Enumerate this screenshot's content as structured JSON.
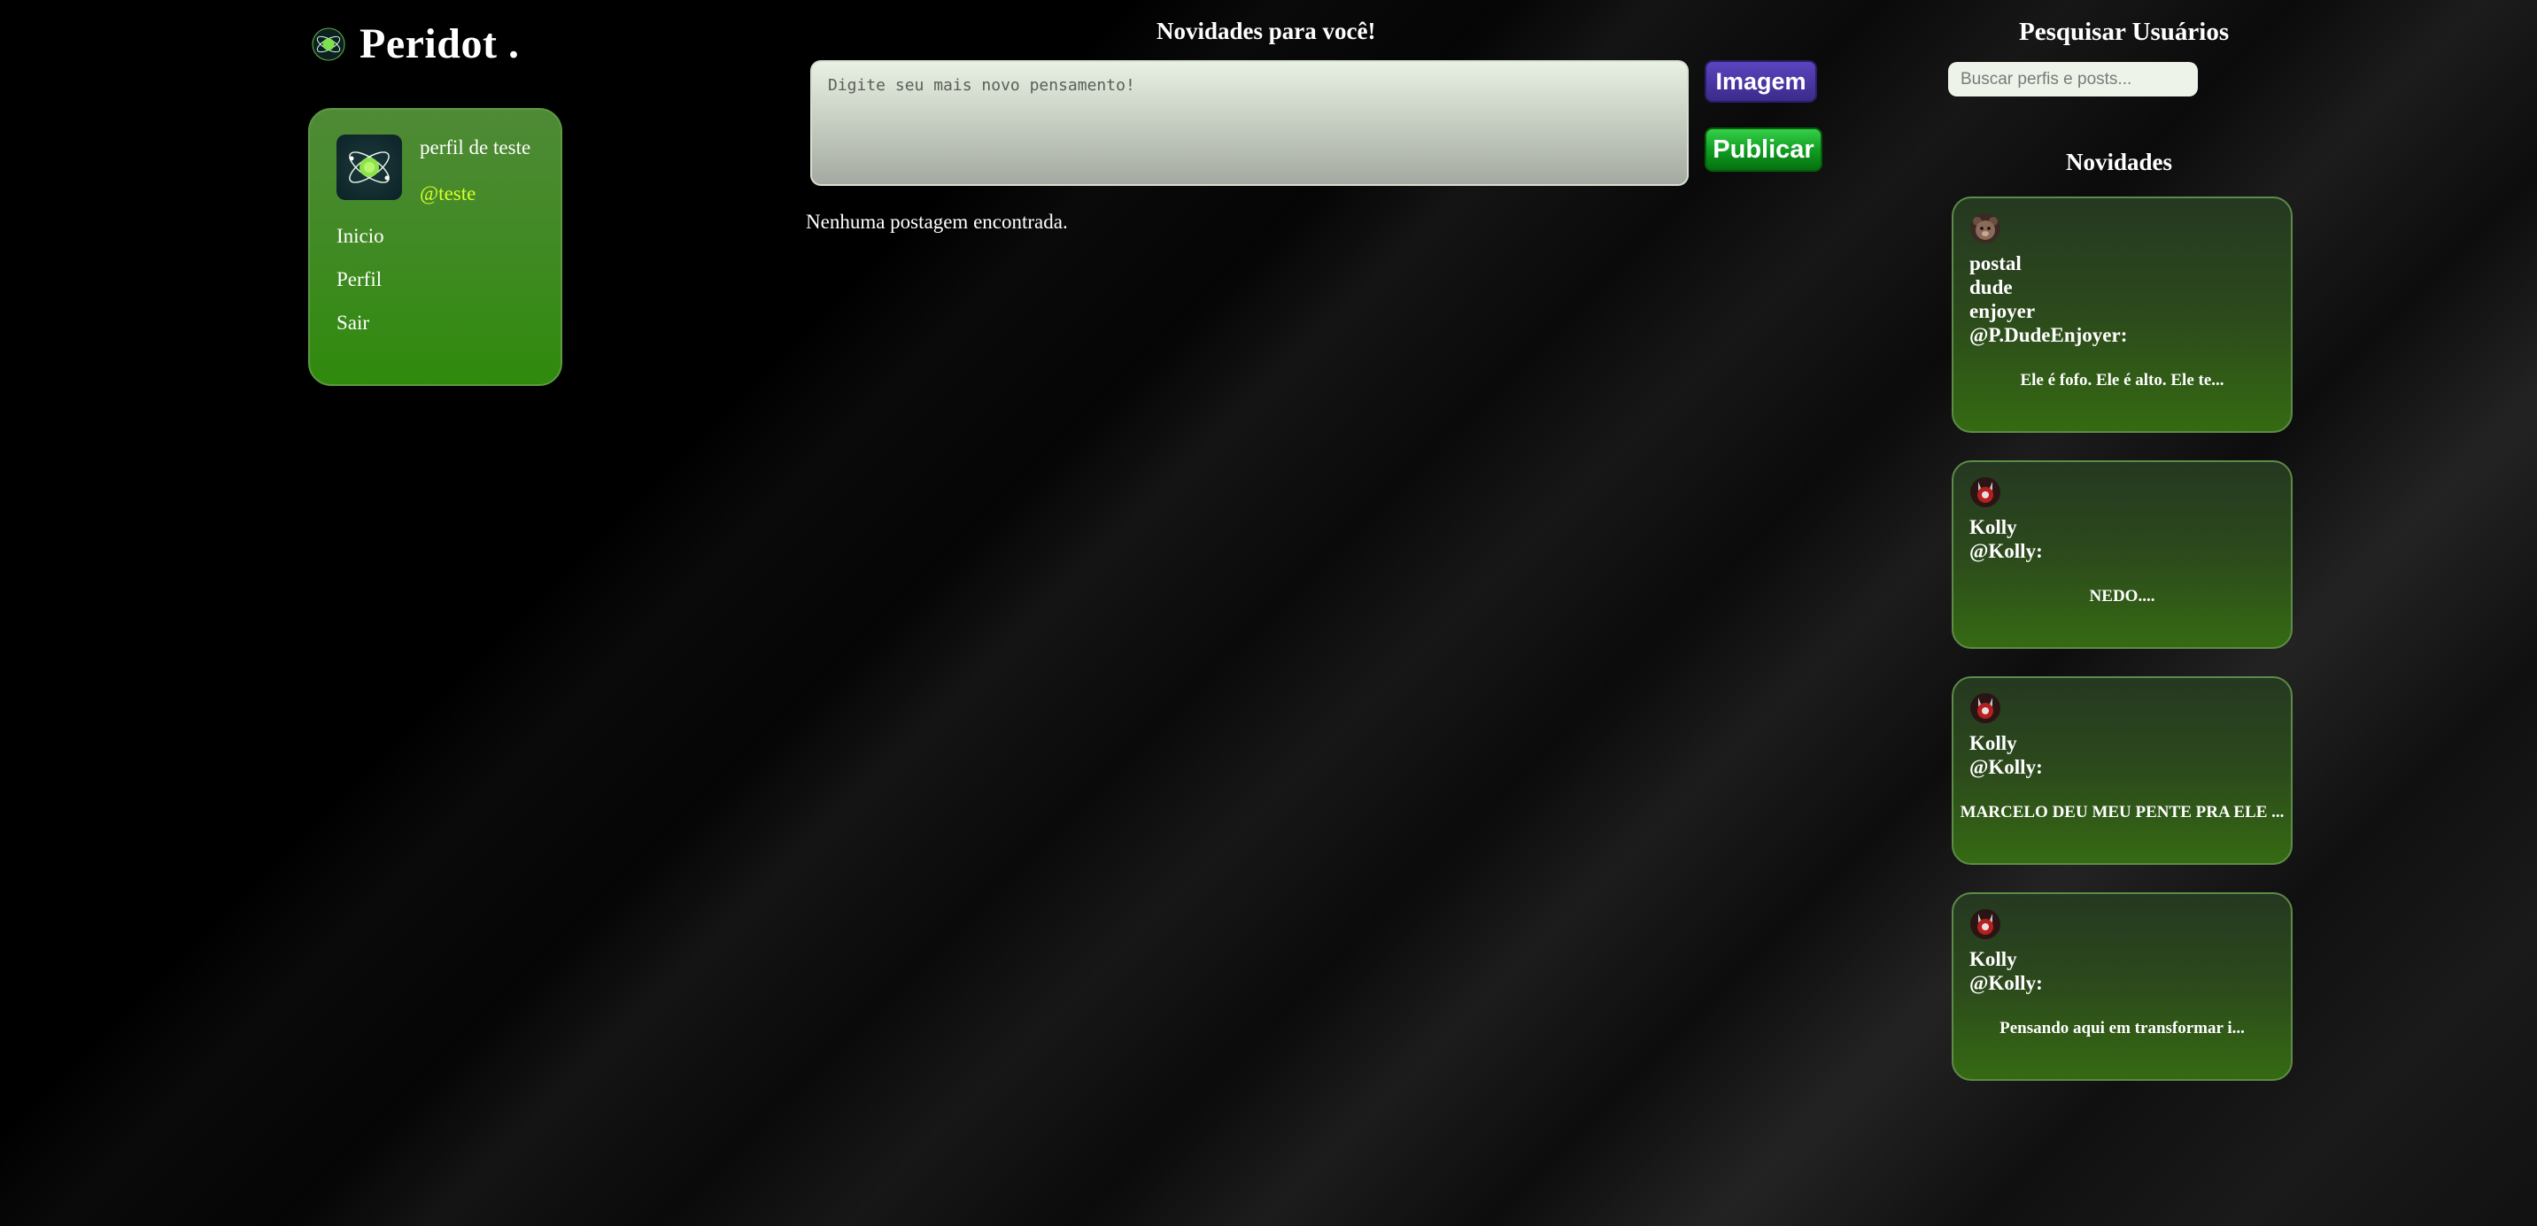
{
  "brand": {
    "name": "Peridot .",
    "logo_icon": "peridot-atom-icon"
  },
  "sidebar": {
    "profile": {
      "name": "perfil de teste",
      "handle": "@teste",
      "avatar_icon": "peridot-atom-icon"
    },
    "nav": [
      {
        "label": "Inicio"
      },
      {
        "label": "Perfil"
      },
      {
        "label": "Sair"
      }
    ]
  },
  "feed": {
    "title": "Novidades para você!",
    "composer_placeholder": "Digite seu mais novo pensamento!",
    "image_button": "Imagem",
    "publish_button": "Publicar",
    "empty_message": "Nenhuma postagem encontrada."
  },
  "search": {
    "title": "Pesquisar Usuários",
    "placeholder": "Buscar perfis e posts..."
  },
  "news": {
    "title": "Novidades",
    "posts": [
      {
        "name_lines": [
          "postal",
          "dude",
          "enjoyer"
        ],
        "handle": "@P.DudeEnjoyer:",
        "text": "Ele é fofo. Ele é alto. Ele te...",
        "avatar_icon": "avatar-bear-icon"
      },
      {
        "name_lines": [
          "Kolly"
        ],
        "handle": "@Kolly:",
        "text": "NEDO....",
        "avatar_icon": "avatar-kolly-icon"
      },
      {
        "name_lines": [
          "Kolly"
        ],
        "handle": "@Kolly:",
        "text": "MARCELO DEU MEU PENTE PRA ELE ...",
        "avatar_icon": "avatar-kolly-icon"
      },
      {
        "name_lines": [
          "Kolly"
        ],
        "handle": "@Kolly:",
        "text": "Pensando aqui em transformar i...",
        "avatar_icon": "avatar-kolly-icon"
      }
    ]
  },
  "colors": {
    "accent_green": "#3f8a22",
    "handle_yellow": "#d8ff2a",
    "image_button": "#3b2b8a",
    "publish_button": "#0f9a20"
  }
}
